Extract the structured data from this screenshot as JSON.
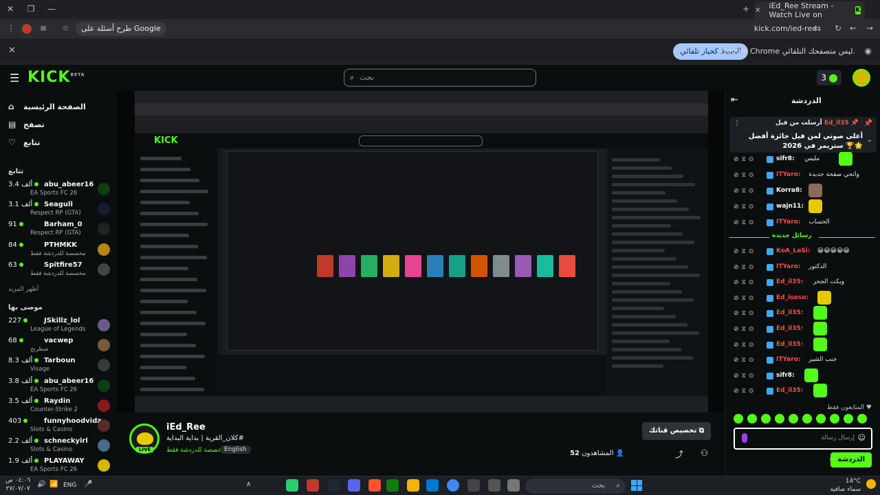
{
  "browser": {
    "tab_title": "iEd_Ree Stream - Watch Live on",
    "url": "kick.com/ied-ree",
    "google_chip": "طرح أسئلة على Google",
    "info_text": "Google Chrome ليس متصفحك التلقائي.",
    "info_button": "الضبط كخيار تلقائي"
  },
  "kick": {
    "logo": "KICK",
    "logo_sup": "BETA",
    "search_placeholder": "بحث",
    "coins": "3"
  },
  "sidebar": {
    "nav": [
      {
        "label": "الصفحة الرئيسية",
        "icon": "home-icon",
        "glyph": "⌂"
      },
      {
        "label": "تصفح",
        "icon": "browse-icon",
        "glyph": "▤"
      },
      {
        "label": "تتابع",
        "icon": "heart-icon",
        "glyph": "♡"
      }
    ],
    "following_heading": "تتابع",
    "following": [
      {
        "name": "abu_abeer16",
        "viewers": "3.4 ألف",
        "game": "EA Sports FC 26",
        "color": "#0f3d14"
      },
      {
        "name": "Seagull",
        "viewers": "3.1 ألف",
        "game": "Respect RP (GTA)",
        "color": "#1a1a2e"
      },
      {
        "name": "Barham_0",
        "viewers": "91",
        "game": "Respect RP (GTA)",
        "color": "#222"
      },
      {
        "name": "PTHMKK",
        "viewers": "84",
        "game": "مخصصة للدردشة فقط",
        "color": "#b8860b"
      },
      {
        "name": "Spitfire57",
        "viewers": "63",
        "game": "مخصصة للدردشة فقط",
        "color": "#444"
      }
    ],
    "show_more": "أظهر المزيد",
    "recommended_heading": "موصى بها",
    "recommended": [
      {
        "name": "JSkillz_lol",
        "viewers": "227",
        "game": "League of Legends",
        "color": "#6a5a8a"
      },
      {
        "name": "vacwep",
        "viewers": "68",
        "game": "شطرنج",
        "color": "#7a5a3a"
      },
      {
        "name": "Tarboun",
        "viewers": "8.3 ألف",
        "game": "Visage",
        "color": "#3a3a3a"
      },
      {
        "name": "abu_abeer16",
        "viewers": "3.8 ألف",
        "game": "EA Sports FC 26",
        "color": "#0f3d14"
      },
      {
        "name": "Raydin",
        "viewers": "3.5 ألف",
        "game": "Counter-Strike 2",
        "color": "#8a1a1a"
      },
      {
        "name": "funnyhoodvidz",
        "viewers": "403",
        "game": "Slots & Casino",
        "color": "#5a2a2a"
      },
      {
        "name": "schneckyirl",
        "viewers": "2.2 ألف",
        "game": "Slots & Casino",
        "color": "#4a6a8a"
      },
      {
        "name": "PLAYAWAY",
        "viewers": "1.9 ألف",
        "game": "EA Sports FC 26",
        "color": "#d4b800"
      }
    ]
  },
  "stream": {
    "streamer": "iEd_Ree",
    "title": "كلان_القرية | بداية البداية#",
    "category": "مخصصة للدردشة فقط",
    "language": "English",
    "live": "LIVE",
    "customize": "تخصيص قناتك",
    "viewers_label": "المشاهدون",
    "viewers": "52"
  },
  "chat": {
    "title": "الدردشة",
    "pinned_from_label": "أرسلت من قبل",
    "pinned_user": "Ed_il35",
    "pinned_text": "أعلى صوتي لمن فيل جائزة أفضل ستريمر في 2026 🏆🌟",
    "new_messages": "رسائل جديدة",
    "messages_before": [
      {
        "user": "sifr8",
        "color": "#ffffff",
        "text": "مليس",
        "emote": "#53fc18"
      },
      {
        "user": "ITYaro",
        "color": "#ff4b4b",
        "text": "واتحي صفحة جديدة",
        "emote": ""
      },
      {
        "user": "Korra8",
        "color": "#ffffff",
        "text": "",
        "emote": "#8a6a5a"
      },
      {
        "user": "wajn11",
        "color": "#ffffff",
        "text": "",
        "emote": "#e8c800"
      },
      {
        "user": "ITYaro",
        "color": "#ff4b4b",
        "text": "الحساب",
        "emote": ""
      }
    ],
    "messages_after": [
      {
        "user": "KoA_LaSi",
        "color": "#ff4b4b",
        "text": "😀😀😀😀😀",
        "emote": ""
      },
      {
        "user": "ITYaro",
        "color": "#ff4b4b",
        "text": "الدكتور",
        "emote": ""
      },
      {
        "user": "Ed_il35",
        "color": "#ff4b4b",
        "text": "وبكت الجحر",
        "emote": ""
      },
      {
        "user": "Ed_isosu",
        "color": "#ff4b4b",
        "text": "",
        "emote": "#e8c800"
      },
      {
        "user": "Ed_il35",
        "color": "#ff4b4b",
        "text": "",
        "emote": "#53fc18"
      },
      {
        "user": "Ed_il35",
        "color": "#ff4b4b",
        "text": "",
        "emote": "#53fc18"
      },
      {
        "user": "Ed_il35",
        "color": "#ff4b4b",
        "text": "",
        "emote": "#53fc18"
      },
      {
        "user": "ITYaro",
        "color": "#ff4b4b",
        "text": "جنب الشير",
        "emote": ""
      },
      {
        "user": "sifr8",
        "color": "#ffffff",
        "text": "",
        "emote": "#53fc18"
      },
      {
        "user": "Ed_il35",
        "color": "#ff4b4b",
        "text": "",
        "emote": "#53fc18"
      }
    ],
    "followers_only": "المتابعون فقط",
    "input_placeholder": "إرسال رسالة",
    "send_label": "الدردشة"
  },
  "taskbar": {
    "time": "٠٤:٠٦ ص",
    "date": "٢٧/٠٧/٠٧",
    "lang": "ENG",
    "search_placeholder": "بحث",
    "temp": "14°C",
    "weather": "سماء صافية"
  },
  "colors": {
    "brand": "#53fc18",
    "background": "#0b0e0f"
  }
}
